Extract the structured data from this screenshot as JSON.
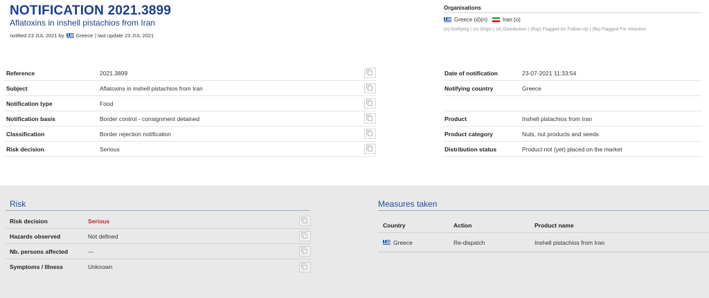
{
  "header": {
    "title": "NOTIFICATION 2021.3899",
    "subtitle": "Aflatoxins in inshell pistachios from Iran",
    "notified_prefix": "notified 23 JUL 2021 by",
    "notified_country": "Greece",
    "last_update": "| last update 23 JUL 2021"
  },
  "organisations": {
    "title": "Organisations",
    "items": [
      {
        "country": "Greece (d)(n)",
        "flag": "greece-flag-icon"
      },
      {
        "country": "Iran (o)",
        "flag": "iran-flag-icon"
      }
    ],
    "legend": "(n) Notifying | (o) Origin | (d) Distribution | (ffup) Flagged for Follow-Up | (ffa) Flagged For Attention"
  },
  "details_left": [
    {
      "label": "Reference",
      "value": "2021.3899"
    },
    {
      "label": "Subject",
      "value": "Aflatoxins in inshell pistachios from Iran"
    },
    {
      "label": "Notification type",
      "value": "Food"
    },
    {
      "label": "Notification basis",
      "value": "Border control - consignment detained"
    },
    {
      "label": "Classification",
      "value": "Border rejection notification"
    },
    {
      "label": "Risk decision",
      "value": "Serious"
    }
  ],
  "details_right": [
    {
      "label": "Date of notification",
      "value": "23-07-2021 11:33:54"
    },
    {
      "label": "Notifying country",
      "value": "Greece"
    },
    {
      "label": "",
      "value": ""
    },
    {
      "label": "Product",
      "value": "Inshell pistachios from Iran"
    },
    {
      "label": "Product category",
      "value": "Nuts, nut products and seeds"
    },
    {
      "label": "Distribution status",
      "value": "Product not (yet) placed on the market"
    }
  ],
  "risk": {
    "title": "Risk",
    "rows": [
      {
        "label": "Risk decision",
        "value": "Serious"
      },
      {
        "label": "Hazards observed",
        "value": "Not defined"
      },
      {
        "label": "Nb. persons affected",
        "value": "---"
      },
      {
        "label": "Symptoms / Illness",
        "value": "Unknown"
      }
    ]
  },
  "measures": {
    "title": "Measures taken",
    "headers": {
      "country": "Country",
      "action": "Action",
      "product": "Product name"
    },
    "rows": [
      {
        "country": "Greece",
        "action": "Re-dispatch",
        "product": "Inshell pistachios from Iran"
      }
    ]
  },
  "colors": {
    "accent": "#1b3f8f",
    "serious": "#c0272d",
    "section_bg": "#e9e9e9"
  }
}
